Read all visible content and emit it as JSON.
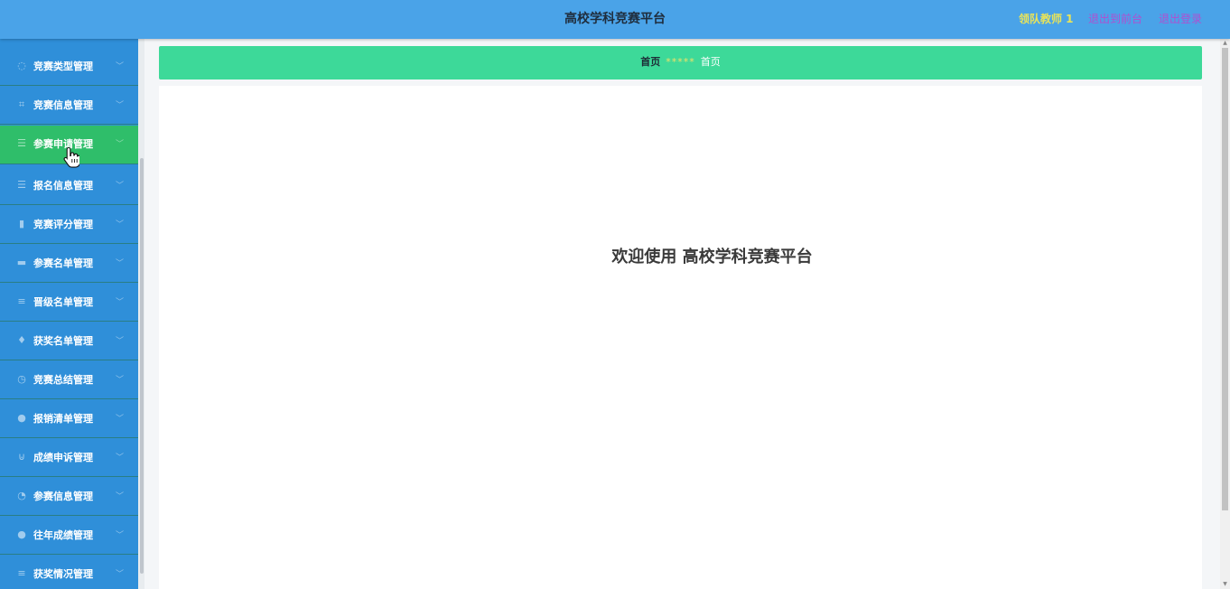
{
  "header": {
    "title": "高校学科竞赛平台",
    "user": "领队教师 1",
    "front_link": "退出到前台",
    "logout_link": "退出登录"
  },
  "sidebar": {
    "items": [
      {
        "label": "竞赛类型管理",
        "icon": "clock-icon",
        "glyph": "◌"
      },
      {
        "label": "竞赛信息管理",
        "icon": "crop-icon",
        "glyph": "⌗"
      },
      {
        "label": "参赛申请管理",
        "icon": "list-icon",
        "glyph": "☰",
        "active": true
      },
      {
        "label": "报名信息管理",
        "icon": "list-icon",
        "glyph": "☰"
      },
      {
        "label": "竞赛评分管理",
        "icon": "bar-chart-icon",
        "glyph": "▮"
      },
      {
        "label": "参赛名单管理",
        "icon": "folder-icon",
        "glyph": "▬"
      },
      {
        "label": "晋级名单管理",
        "icon": "menu-icon",
        "glyph": "≡"
      },
      {
        "label": "获奖名单管理",
        "icon": "trophy-icon",
        "glyph": "♦"
      },
      {
        "label": "竞赛总结管理",
        "icon": "clock-icon",
        "glyph": "◷"
      },
      {
        "label": "报销清单管理",
        "icon": "location-icon",
        "glyph": "●"
      },
      {
        "label": "成绩申诉管理",
        "icon": "microphone-icon",
        "glyph": "⊍"
      },
      {
        "label": "参赛信息管理",
        "icon": "bell-icon",
        "glyph": "◔"
      },
      {
        "label": "往年成绩管理",
        "icon": "user-icon",
        "glyph": "●"
      },
      {
        "label": "获奖情况管理",
        "icon": "menu-icon",
        "glyph": "≡"
      }
    ]
  },
  "breadcrumb": {
    "home": "首页",
    "separator": "*****",
    "current": "首页"
  },
  "main": {
    "welcome": "欢迎使用 高校学科竞赛平台"
  },
  "colors": {
    "topbar": "#4aa3e8",
    "sidebar": "#2f8fd9",
    "active_item": "#2fbe6a",
    "breadcrumb": "#3dd999"
  }
}
